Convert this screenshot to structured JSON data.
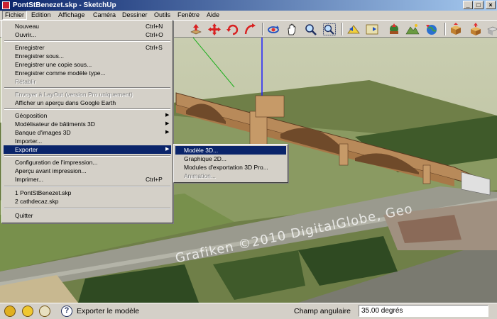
{
  "window": {
    "title": "PontStBenezet.skp - SketchUp"
  },
  "menubar": {
    "items": [
      {
        "label": "Fichier"
      },
      {
        "label": "Edition"
      },
      {
        "label": "Affichage"
      },
      {
        "label": "Caméra"
      },
      {
        "label": "Dessiner"
      },
      {
        "label": "Outils"
      },
      {
        "label": "Fenêtre"
      },
      {
        "label": "Aide"
      }
    ]
  },
  "file_menu": {
    "items": [
      {
        "label": "Nouveau",
        "shortcut": "Ctrl+N"
      },
      {
        "label": "Ouvrir...",
        "shortcut": "Ctrl+O"
      },
      {
        "label": "Enregistrer",
        "shortcut": "Ctrl+S"
      },
      {
        "label": "Enregistrer sous..."
      },
      {
        "label": "Enregistrer une copie sous..."
      },
      {
        "label": "Enregistrer comme modèle type..."
      },
      {
        "label": "Rétablir"
      },
      {
        "label": "Envoyer à LayOut (version Pro uniquement)"
      },
      {
        "label": "Afficher un aperçu dans Google Earth"
      },
      {
        "label": "Géoposition"
      },
      {
        "label": "Modélisateur de bâtiments 3D"
      },
      {
        "label": "Banque d'images 3D"
      },
      {
        "label": "Importer..."
      },
      {
        "label": "Exporter"
      },
      {
        "label": "Configuration de l'impression..."
      },
      {
        "label": "Aperçu avant impression..."
      },
      {
        "label": "Imprimer...",
        "shortcut": "Ctrl+P"
      },
      {
        "label": "1 PontStBenezet.skp"
      },
      {
        "label": "2 cathdecaz.skp"
      },
      {
        "label": "Quitter"
      }
    ]
  },
  "export_submenu": {
    "items": [
      {
        "label": "Modèle 3D..."
      },
      {
        "label": "Graphique 2D..."
      },
      {
        "label": "Modules d'exportation 3D Pro..."
      },
      {
        "label": "Animation..."
      }
    ]
  },
  "toolbar": {
    "icons": [
      "push-pull-icon",
      "move-icon",
      "rotate-icon",
      "follow-me-icon",
      "orbit-icon",
      "pan-icon",
      "zoom-icon",
      "zoom-extents-icon",
      "previous-view-icon",
      "next-view-icon",
      "add-location-icon",
      "toggle-terrain-icon",
      "photo-textures-icon",
      "get-models-icon",
      "share-model-icon"
    ]
  },
  "viewport": {
    "watermark": "Grafiken ©2010 DigitalGlobe, Geo"
  },
  "statusbar": {
    "message": "Exporter le modèle",
    "vcb_label": "Champ angulaire",
    "vcb_value": "35.00 degrés"
  },
  "colors": {
    "menu_highlight": "#0a246a",
    "title_gradient_start": "#0a246a",
    "title_gradient_end": "#a6caf0"
  }
}
